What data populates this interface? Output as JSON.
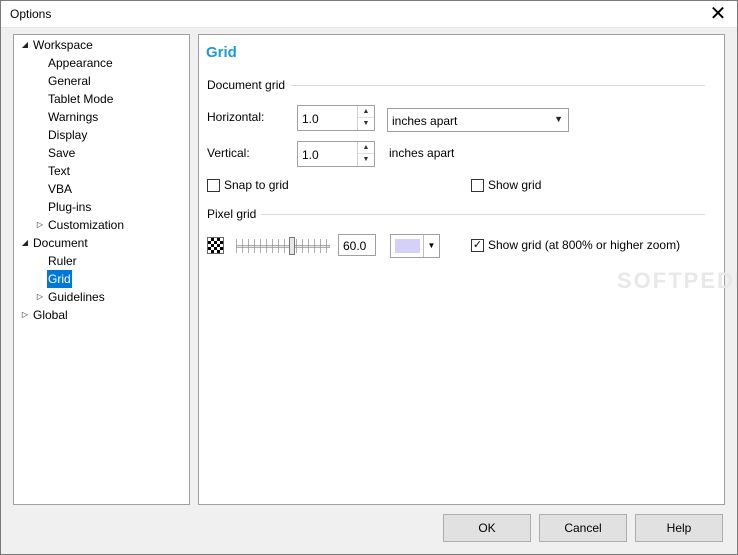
{
  "window": {
    "title": "Options"
  },
  "tree": {
    "items": [
      {
        "label": "Workspace",
        "level": 0,
        "expander": "expanded"
      },
      {
        "label": "Appearance",
        "level": 1,
        "expander": "none"
      },
      {
        "label": "General",
        "level": 1,
        "expander": "none"
      },
      {
        "label": "Tablet Mode",
        "level": 1,
        "expander": "none"
      },
      {
        "label": "Warnings",
        "level": 1,
        "expander": "none"
      },
      {
        "label": "Display",
        "level": 1,
        "expander": "none"
      },
      {
        "label": "Save",
        "level": 1,
        "expander": "none"
      },
      {
        "label": "Text",
        "level": 1,
        "expander": "none"
      },
      {
        "label": "VBA",
        "level": 1,
        "expander": "none"
      },
      {
        "label": "Plug-ins",
        "level": 1,
        "expander": "none"
      },
      {
        "label": "Customization",
        "level": 1,
        "expander": "collapsed"
      },
      {
        "label": "Document",
        "level": 0,
        "expander": "expanded"
      },
      {
        "label": "Ruler",
        "level": 1,
        "expander": "none"
      },
      {
        "label": "Grid",
        "level": 1,
        "expander": "none",
        "selected": true
      },
      {
        "label": "Guidelines",
        "level": 1,
        "expander": "collapsed"
      },
      {
        "label": "Global",
        "level": 0,
        "expander": "collapsed"
      }
    ]
  },
  "content": {
    "title": "Grid",
    "document_grid": {
      "section_label": "Document grid",
      "horizontal_label": "Horizontal:",
      "horizontal_value": "1.0",
      "horizontal_unit_option": "inches apart",
      "vertical_label": "Vertical:",
      "vertical_value": "1.0",
      "vertical_unit": "inches apart",
      "snap_label": "Snap to grid",
      "snap_checked": false,
      "show_label": "Show grid",
      "show_checked": false
    },
    "pixel_grid": {
      "section_label": "Pixel grid",
      "opacity_value": "60.0",
      "slider_level_percent": 60,
      "color": "#d4d0f8",
      "show_label": "Show grid (at 800% or higher zoom)",
      "show_checked": true
    },
    "watermark": "SOFTPEDIA"
  },
  "buttons": {
    "ok": "OK",
    "cancel": "Cancel",
    "help": "Help"
  },
  "colors": {
    "accent": "#1e9bd7",
    "selection": "#0078d7"
  }
}
